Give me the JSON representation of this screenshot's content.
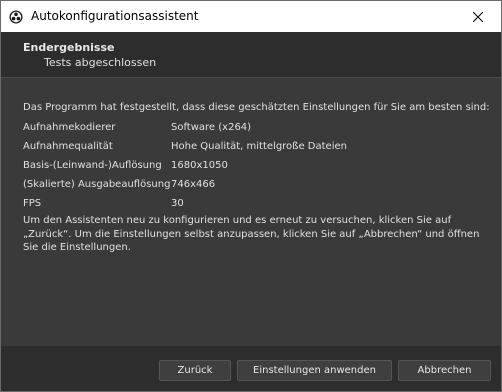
{
  "window": {
    "title": "Autokonfigurationsassistent"
  },
  "header": {
    "title": "Endergebnisse",
    "subtitle": "Tests abgeschlossen"
  },
  "results": {
    "intro": "Das Programm hat festgestellt, dass diese geschätzten Einstellungen für Sie am besten sind:",
    "rows": [
      {
        "label": "Aufnahmekodierer",
        "value": "Software (x264)"
      },
      {
        "label": "Aufnahmequalität",
        "value": "Hohe Qualität, mittelgroße Dateien"
      },
      {
        "label": "Basis-(Leinwand-)Auflösung",
        "value": "1680x1050"
      },
      {
        "label": "(Skalierte) Ausgabeauflösung",
        "value": "746x466"
      },
      {
        "label": "FPS",
        "value": "30"
      }
    ],
    "note": "Um den Assistenten neu zu konfigurieren und es erneut zu versuchen, klicken Sie auf „Zurück“. Um die Einstellungen selbst anzupassen, klicken Sie auf „Abbrechen“ und öffnen Sie die Einstellungen."
  },
  "buttons": {
    "back": "Zurück",
    "apply": "Einstellungen anwenden",
    "cancel": "Abbrechen"
  }
}
